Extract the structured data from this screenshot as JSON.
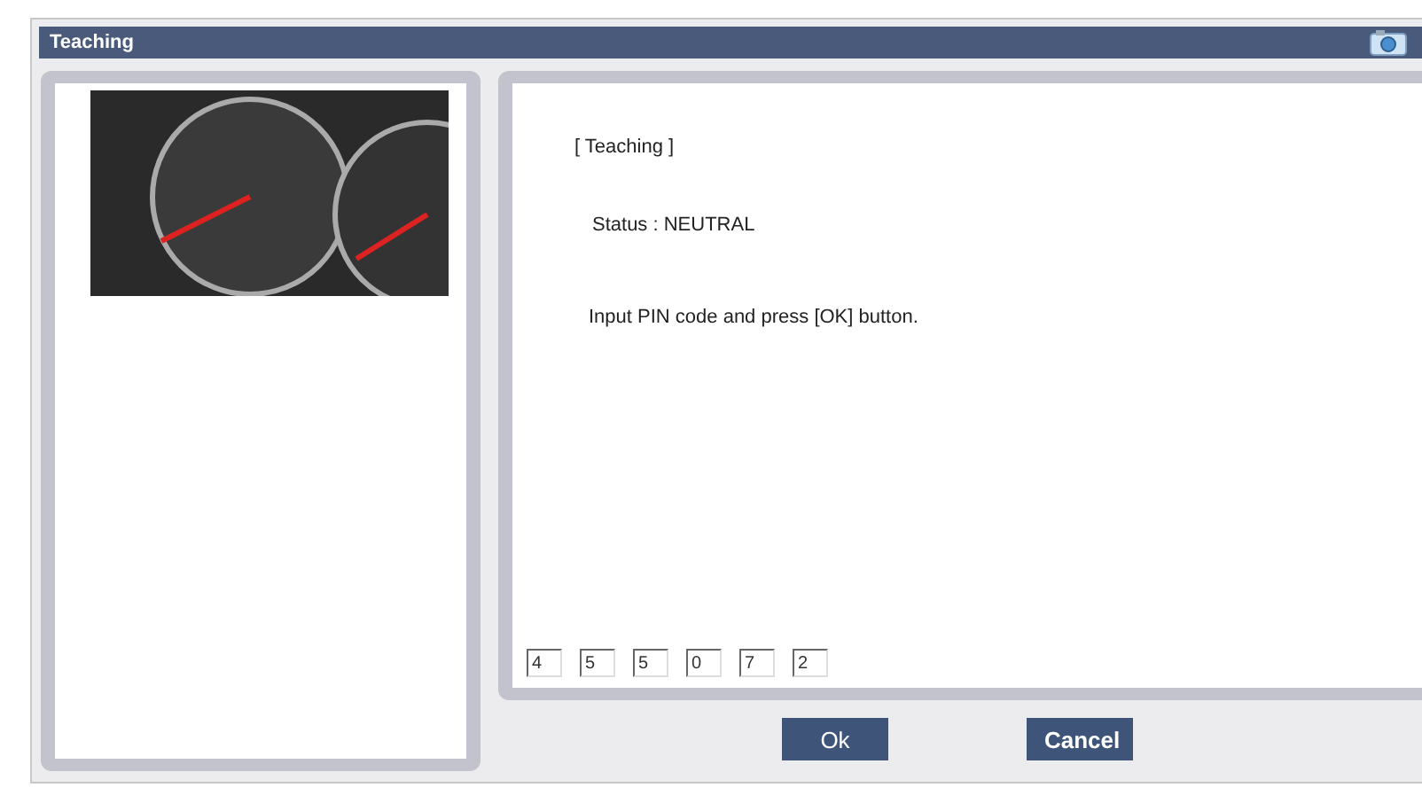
{
  "window": {
    "title": "Teaching"
  },
  "content": {
    "heading": "[ Teaching ]",
    "status": "Status : NEUTRAL",
    "instruction": "Input PIN code and press [OK] button."
  },
  "pin_digits": [
    "4",
    "5",
    "5",
    "0",
    "7",
    "2"
  ],
  "buttons": [
    {
      "label": "Ok",
      "kind": "ok"
    },
    {
      "label": "Cancel",
      "kind": "cancel"
    }
  ]
}
